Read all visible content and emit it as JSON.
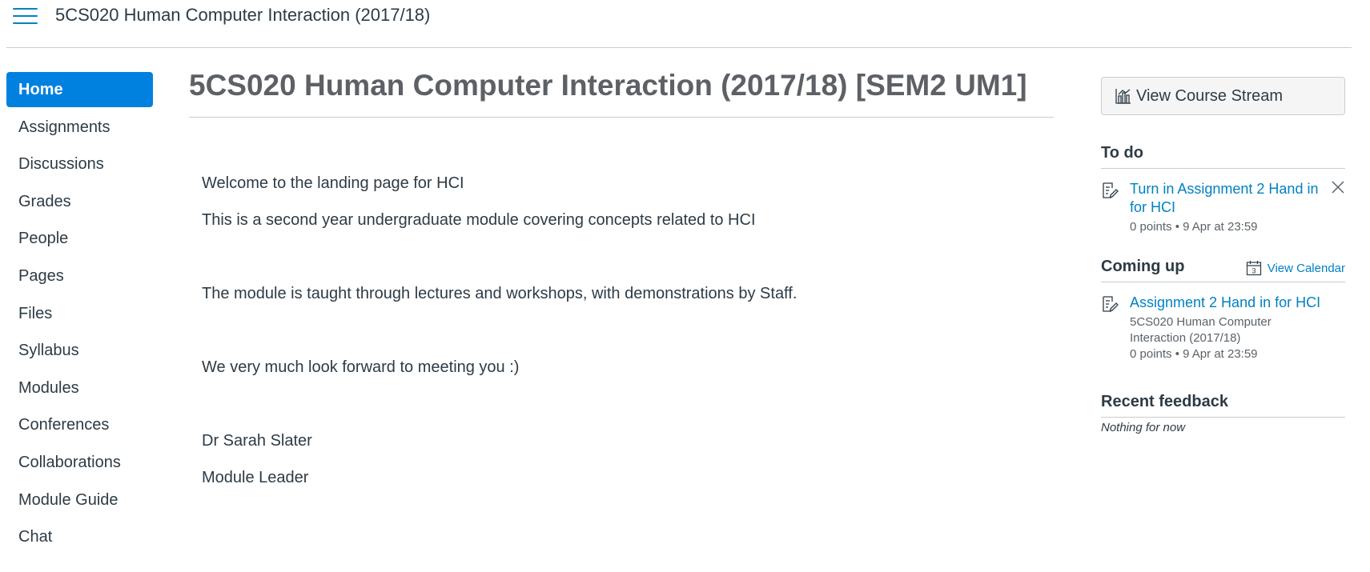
{
  "header": {
    "course_title": "5CS020 Human Computer Interaction (2017/18)"
  },
  "nav": {
    "items": [
      {
        "label": "Home",
        "active": true
      },
      {
        "label": "Assignments"
      },
      {
        "label": "Discussions"
      },
      {
        "label": "Grades"
      },
      {
        "label": "People"
      },
      {
        "label": "Pages"
      },
      {
        "label": "Files"
      },
      {
        "label": "Syllabus"
      },
      {
        "label": "Modules"
      },
      {
        "label": "Conferences"
      },
      {
        "label": "Collaborations"
      },
      {
        "label": "Module Guide"
      },
      {
        "label": "Chat"
      }
    ]
  },
  "main": {
    "heading": "5CS020 Human Computer Interaction (2017/18) [SEM2 UM1]",
    "paragraphs": [
      "Welcome to the landing page for HCI",
      "This is a second year undergraduate module covering concepts related to HCI",
      "The module is taught through lectures and workshops, with demonstrations by Staff.",
      "We very much look forward to meeting you :)",
      "Dr Sarah Slater",
      "Module Leader"
    ]
  },
  "sidebar": {
    "stream_button": "View Course Stream",
    "todo": {
      "heading": "To do",
      "items": [
        {
          "title": "Turn in Assignment 2 Hand in for HCI",
          "meta": "0 points • 9 Apr at 23:59"
        }
      ]
    },
    "coming_up": {
      "heading": "Coming up",
      "calendar_link": "View Calendar",
      "calendar_day": "3",
      "items": [
        {
          "title": "Assignment 2 Hand in for HCI",
          "course": "5CS020 Human Computer Interaction (2017/18)",
          "meta": "0 points • 9 Apr at 23:59"
        }
      ]
    },
    "feedback": {
      "heading": "Recent feedback",
      "empty": "Nothing for now"
    }
  },
  "colors": {
    "accent": "#0081c2",
    "active_nav": "#0081e0",
    "text": "#2d3b45",
    "heading": "#5d6166",
    "divider": "#c7cdd1"
  },
  "icons": [
    "hamburger-icon",
    "chart-icon",
    "assignment-icon",
    "close-icon",
    "calendar-icon"
  ]
}
